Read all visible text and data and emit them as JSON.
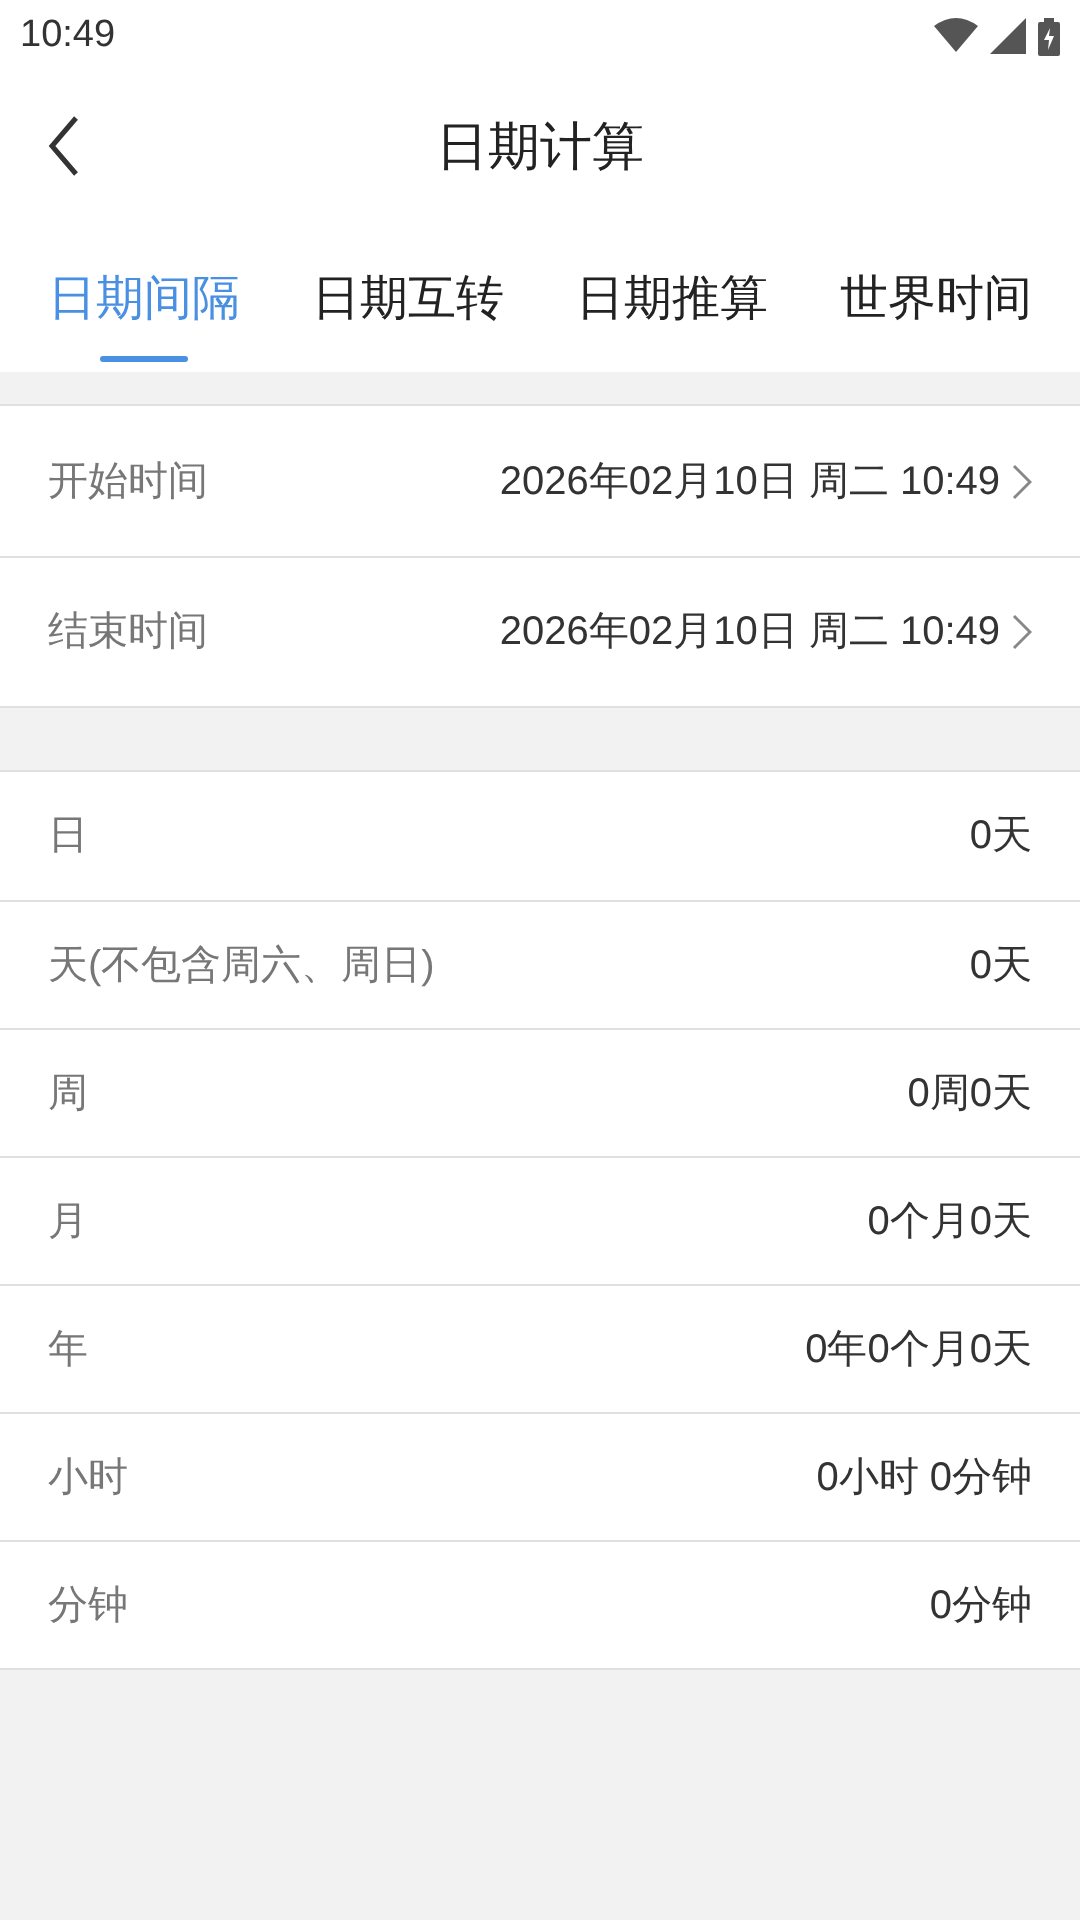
{
  "status_bar": {
    "time": "10:49"
  },
  "header": {
    "title": "日期计算"
  },
  "tabs": [
    {
      "label": "日期间隔",
      "selected": true
    },
    {
      "label": "日期互转",
      "selected": false
    },
    {
      "label": "日期推算",
      "selected": false
    },
    {
      "label": "世界时间",
      "selected": false
    }
  ],
  "time_rows": [
    {
      "label": "开始时间",
      "value": "2026年02月10日 周二 10:49"
    },
    {
      "label": "结束时间",
      "value": "2026年02月10日 周二 10:49"
    }
  ],
  "results": [
    {
      "label": "日",
      "value": "0天"
    },
    {
      "label": "天(不包含周六、周日)",
      "value": "0天"
    },
    {
      "label": "周",
      "value": "0周0天"
    },
    {
      "label": "月",
      "value": "0个月0天"
    },
    {
      "label": "年",
      "value": "0年0个月0天"
    },
    {
      "label": "小时",
      "value": "0小时 0分钟"
    },
    {
      "label": "分钟",
      "value": "0分钟"
    }
  ]
}
